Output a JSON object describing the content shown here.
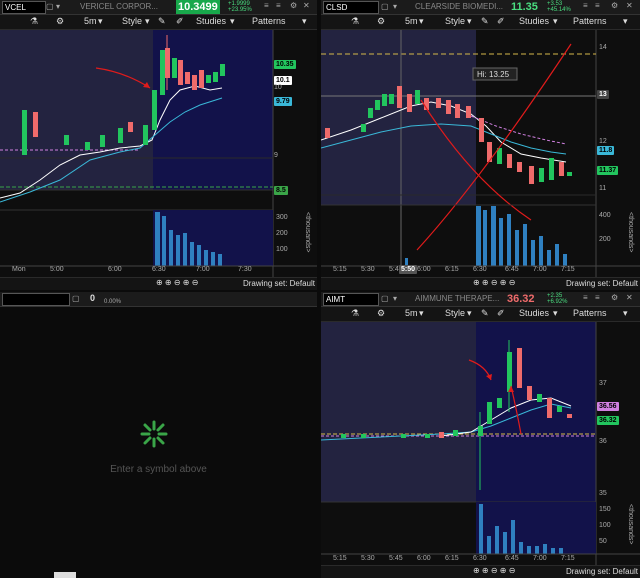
{
  "panels": {
    "vcel": {
      "symbol": "VCEL",
      "name": "VERICEL CORPOR...",
      "price": "10.3499",
      "change": "+1.9999",
      "change_pct": "+23.95%",
      "price_tags": [
        "10.35",
        "10.1",
        "9.79",
        "8.5"
      ],
      "y_ticks": [
        "10",
        "9"
      ],
      "vol_ticks": [
        "300",
        "200",
        "100"
      ],
      "x_ticks": [
        "Mon",
        "5:00",
        "6:00",
        "6:30",
        "7:00",
        "7:30"
      ],
      "unit_label": "<thousands>"
    },
    "clsd": {
      "symbol": "CLSD",
      "name": "CLEARSIDE BIOMEDI...",
      "price": "11.35",
      "change": "+3.53",
      "change_pct": "+45.14%",
      "hi_label": "Hi: 13.25",
      "price_tags": [
        "13",
        "11.8",
        "11.37"
      ],
      "y_ticks": [
        "14",
        "12",
        "11"
      ],
      "vol_ticks": [
        "400",
        "200"
      ],
      "x_ticks": [
        "5:15",
        "5:30",
        "5:45",
        "6:00",
        "6:15",
        "6:30",
        "6:45",
        "7:00",
        "7:15"
      ],
      "cursor_time": "5:50",
      "unit_label": "<thousands>"
    },
    "empty": {
      "qty": "0",
      "pct": "0.00%",
      "prompt": "Enter a symbol above"
    },
    "aimt": {
      "symbol": "AIMT",
      "name": "AIMMUNE THERAPE...",
      "price": "36.32",
      "change": "+2.35",
      "change_pct": "+6.92%",
      "price_tags": [
        "36.56",
        "36.32"
      ],
      "y_ticks": [
        "37",
        "36",
        "35"
      ],
      "vol_ticks": [
        "150",
        "100",
        "50"
      ],
      "x_ticks": [
        "5:15",
        "5:30",
        "5:45",
        "6:00",
        "6:15",
        "6:30",
        "6:45",
        "7:00",
        "7:15"
      ],
      "unit_label": "<thousands>"
    }
  },
  "toolbar": {
    "timeframe": "5m",
    "style_label": "Style",
    "studies_label": "Studies",
    "patterns_label": "Patterns",
    "drawing_set_label": "Drawing set: Default"
  },
  "colors": {
    "up": "#22c55e",
    "down": "#ef6b6b",
    "vol": "#2f80c0",
    "bg_pre": "#232340",
    "bg_reg": "#12124a",
    "ema_white": "#ffffff",
    "ema_teal": "#3ab8d8",
    "annotation": "#e01b1b",
    "price_green": "#18a84b",
    "price_red": "#c62828"
  }
}
